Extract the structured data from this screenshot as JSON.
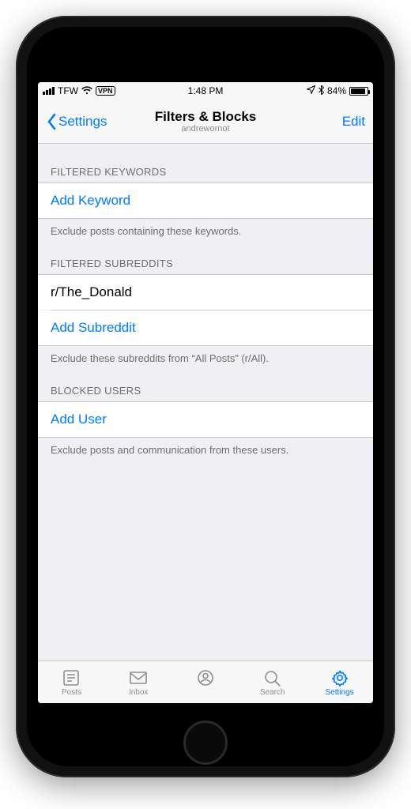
{
  "status": {
    "carrier": "TFW",
    "vpn": "VPN",
    "time": "1:48 PM",
    "battery_pct": "84%"
  },
  "nav": {
    "back_label": "Settings",
    "title": "Filters & Blocks",
    "subtitle": "andrewornot",
    "edit_label": "Edit"
  },
  "sections": {
    "keywords": {
      "header": "FILTERED KEYWORDS",
      "add_label": "Add Keyword",
      "footer": "Exclude posts containing these keywords."
    },
    "subreddits": {
      "header": "FILTERED SUBREDDITS",
      "items": [
        "r/The_Donald"
      ],
      "add_label": "Add Subreddit",
      "footer": "Exclude these subreddits from “All Posts” (r/All)."
    },
    "users": {
      "header": "BLOCKED USERS",
      "add_label": "Add User",
      "footer": "Exclude posts and communication from these users."
    }
  },
  "tabs": {
    "posts": "Posts",
    "inbox": "Inbox",
    "search": "Search",
    "settings": "Settings"
  }
}
